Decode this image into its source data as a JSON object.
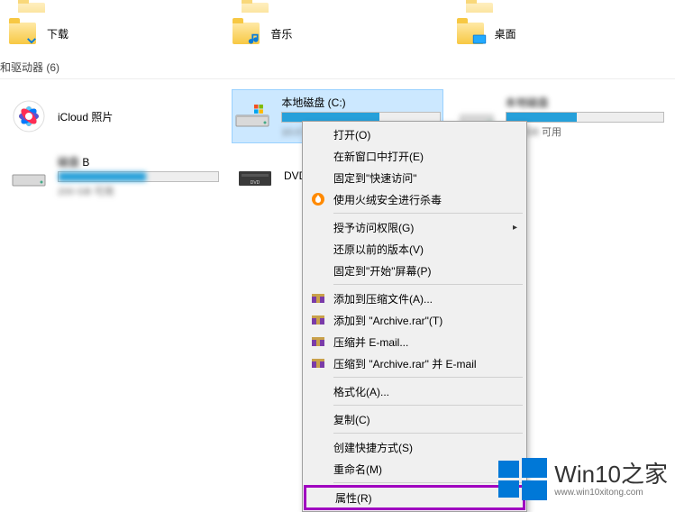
{
  "libraries": {
    "downloads": "下载",
    "music": "音乐",
    "desktop": "桌面"
  },
  "section_header": "和驱动器 (6)",
  "drives": {
    "icloud": "iCloud 照片",
    "local_c": "本地磁盘 (C:)",
    "dvd": "DVD",
    "drive_b_suffix": "B",
    "avail_suffix": "可用"
  },
  "context_menu": {
    "open": "打开(O)",
    "new_window": "在新窗口中打开(E)",
    "pin_quick": "固定到\"快速访问\"",
    "huorong": "使用火绒安全进行杀毒",
    "grant_access": "授予访问权限(G)",
    "restore_prev": "还原以前的版本(V)",
    "pin_start": "固定到\"开始\"屏幕(P)",
    "add_archive": "添加到压缩文件(A)...",
    "add_archive_rar": "添加到 \"Archive.rar\"(T)",
    "compress_email": "压缩并 E-mail...",
    "compress_rar_email": "压缩到 \"Archive.rar\" 并 E-mail",
    "format": "格式化(A)...",
    "copy": "复制(C)",
    "create_shortcut": "创建快捷方式(S)",
    "rename": "重命名(M)",
    "properties": "属性(R)"
  },
  "watermark": {
    "main": "Win10之家",
    "url": "www.win10xitong.com"
  }
}
